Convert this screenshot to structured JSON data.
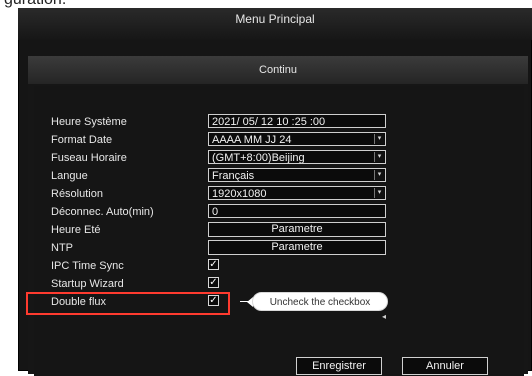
{
  "caption": "guration.",
  "window": {
    "title": "Menu Principal"
  },
  "panel": {
    "title": "Continu"
  },
  "settings": {
    "system_time": {
      "label": "Heure Système",
      "value": "2021/ 05/ 12  10 :25 :00"
    },
    "date_format": {
      "label": "Format Date",
      "value": "AAAA MM JJ 24"
    },
    "time_zone": {
      "label": "Fuseau Horaire",
      "value": "(GMT+8:00)Beijing"
    },
    "language": {
      "label": "Langue",
      "value": "Français"
    },
    "resolution": {
      "label": "Résolution",
      "value": "1920x1080"
    },
    "auto_logout": {
      "label": "Déconnec. Auto(min)",
      "value": "0"
    },
    "dst": {
      "label": "Heure Eté",
      "button": "Parametre"
    },
    "ntp": {
      "label": "NTP",
      "button": "Parametre"
    },
    "ipc_time_sync": {
      "label": "IPC Time Sync",
      "checked": true
    },
    "startup_wizard": {
      "label": "Startup Wizard",
      "checked": true
    },
    "double_flux": {
      "label": "Double flux",
      "checked": true
    }
  },
  "callout": {
    "text": "Uncheck the checkbox"
  },
  "buttons": {
    "save": "Enregistrer",
    "cancel": "Annuler"
  },
  "glyphs": {
    "checkmark": "✓",
    "dropdown_arrow": "▾",
    "tiny_caret": "◂"
  },
  "colors": {
    "highlight": "#ff3b2f",
    "background": "#151515",
    "text": "#e7e7e7"
  }
}
